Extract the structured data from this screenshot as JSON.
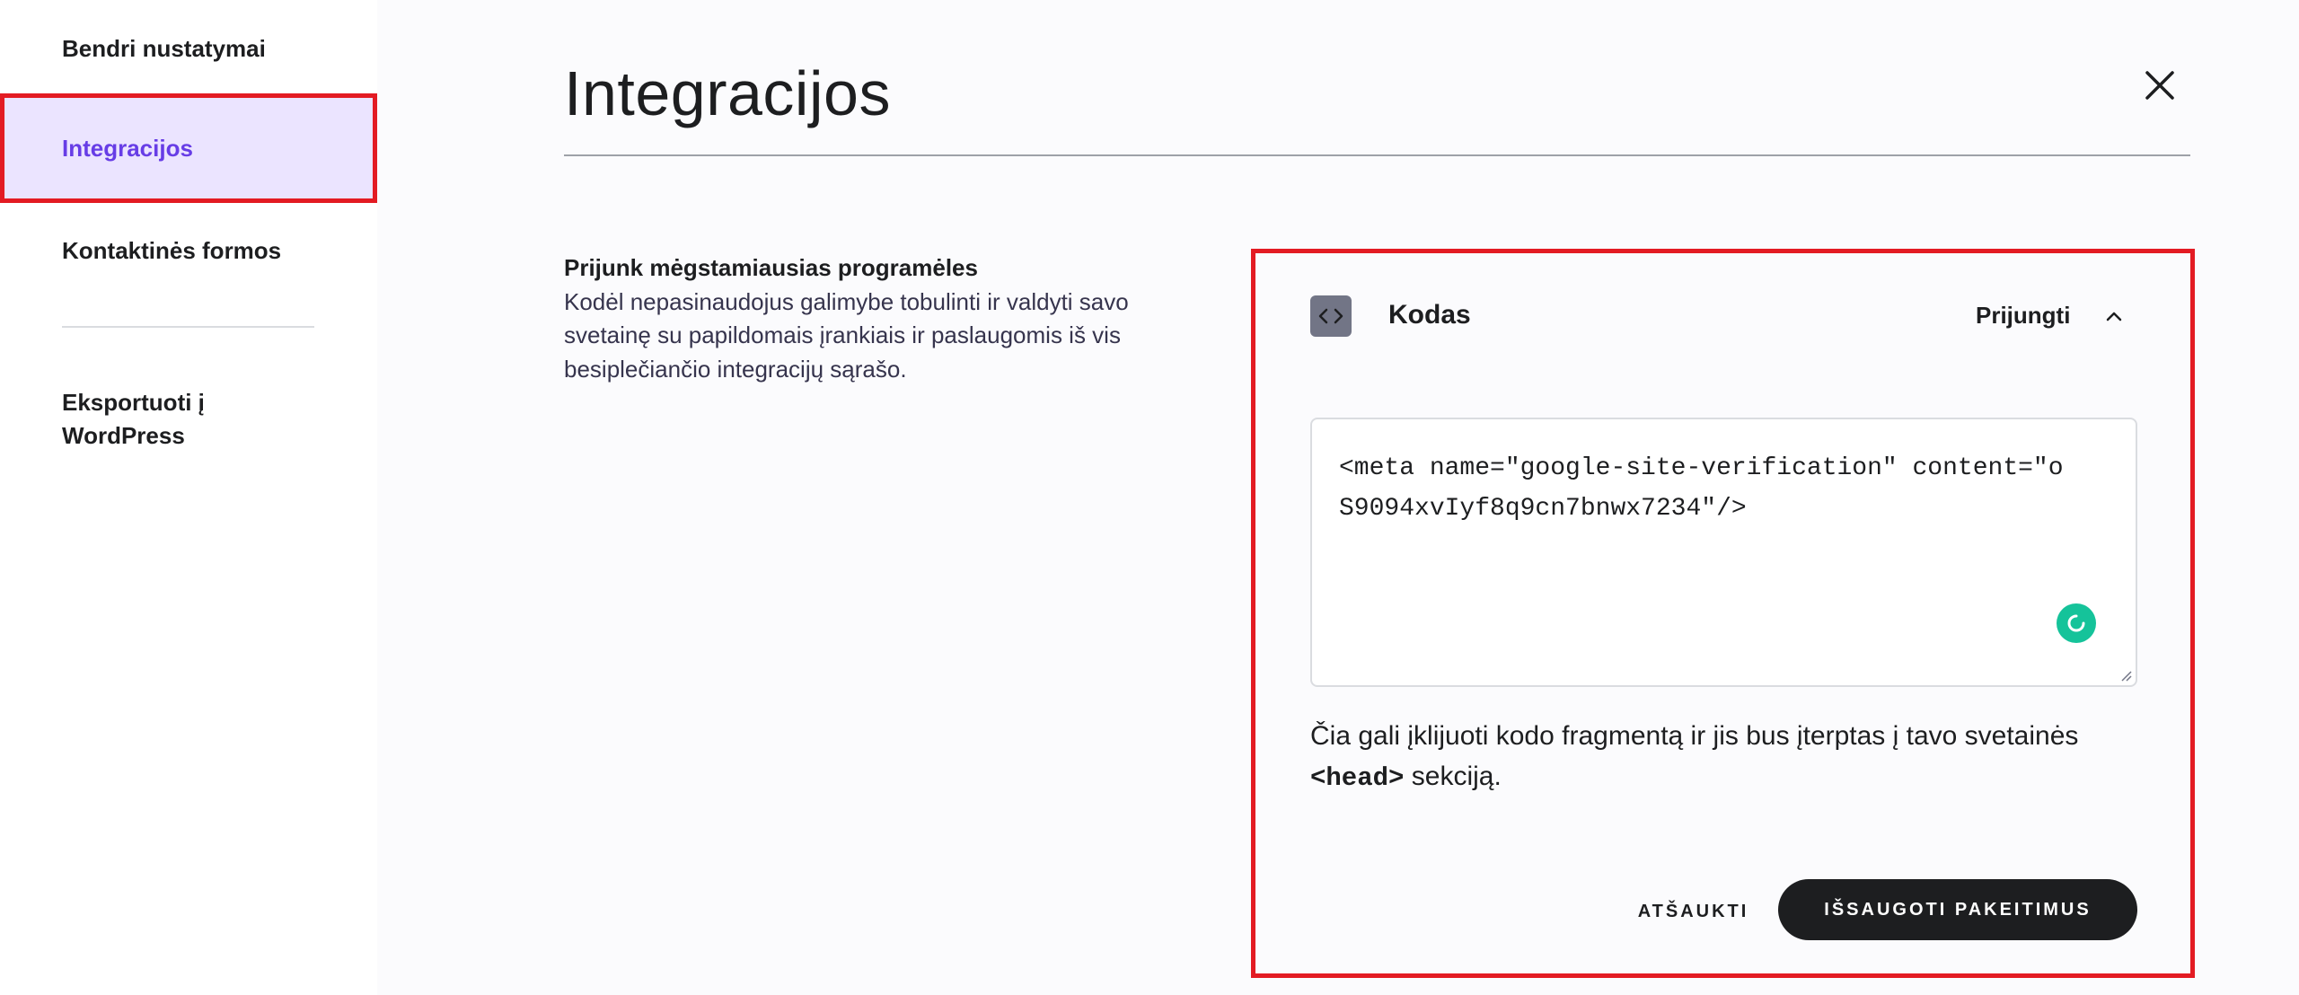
{
  "sidebar": {
    "items": [
      {
        "label": "Bendri nustatymai"
      },
      {
        "label": "Integracijos",
        "active": true
      },
      {
        "label": "Kontaktinės formos"
      },
      {
        "label": "Eksportuoti į WordPress"
      }
    ]
  },
  "header": {
    "title": "Integracijos"
  },
  "intro": {
    "heading": "Prijunk mėgstamiausias programėles",
    "description": "Kodėl nepasinaudojus galimybe tobulinti ir valdyti savo svetainę su papildomais įrankiais ir paslaugomis iš vis besiplečiančio integracijų sąrašo."
  },
  "card": {
    "title": "Kodas",
    "connect_label": "Prijungti",
    "code_value": "<meta name=\"google-site-verification\" content=\"oS9094xvIyf8q9cn7bnwx7234\"/>",
    "helper_prefix": "Čia gali įklijuoti kodo fragmentą ir jis bus įterptas į tavo svetainės ",
    "helper_tag": "<head>",
    "helper_suffix": " sekciją.",
    "cancel_label": "ATŠAUKTI",
    "save_label": "IŠSAUGOTI PAKEITIMUS"
  },
  "colors": {
    "accent": "#673de6",
    "active_bg": "#ebe4ff",
    "highlight": "#e31b23",
    "dark": "#1d1e20",
    "grammar": "#15c39a"
  },
  "icons": {
    "close": "close-icon",
    "code": "code-icon",
    "chevron": "chevron-up-icon",
    "grammar": "grammarly-icon"
  }
}
